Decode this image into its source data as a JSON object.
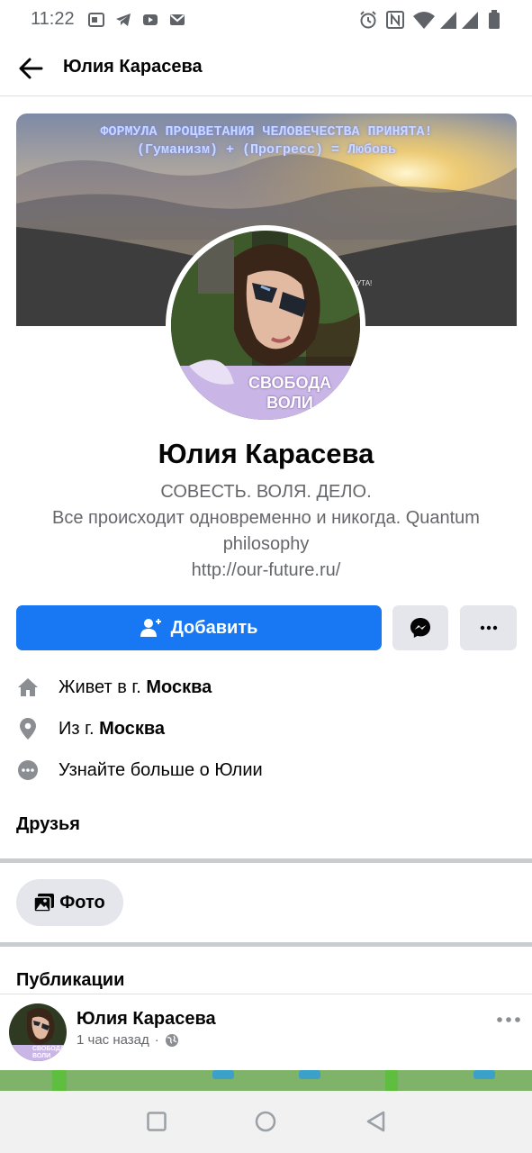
{
  "status_bar": {
    "time": "11:22"
  },
  "app_bar": {
    "title": "Юлия Карасева"
  },
  "cover": {
    "line1": "ФОРМУЛА ПРОЦВЕТАНИЯ ЧЕЛОВЕЧЕСТВА ПРИНЯТА!",
    "line2": "(Гуманизм) + (Прогресс) = Любовь",
    "small_right": "УТА!"
  },
  "avatar": {
    "caption_line1": "СВОБОДА",
    "caption_line2": "ВОЛИ"
  },
  "profile": {
    "name": "Юлия Карасева",
    "bio_line1": "СОВЕСТЬ. ВОЛЯ. ДЕЛО.",
    "bio_line2": "Все происходит одновременно и никогда. Quantum",
    "bio_line3": "philosophy",
    "bio_line4": "http://our-future.ru/"
  },
  "actions": {
    "add_label": "Добавить"
  },
  "info": {
    "lives_prefix": "Живет в г.",
    "lives_city": "Москва",
    "from_prefix": "Из г.",
    "from_city": "Москва",
    "more_about": "Узнайте больше о Юлии"
  },
  "sections": {
    "friends": "Друзья",
    "photos_chip": "Фото",
    "publications": "Публикации"
  },
  "post": {
    "author": "Юлия Карасева",
    "time": "1 час назад",
    "separator": "·",
    "avatar_caption": "СВОБОДА ВОЛИ"
  },
  "colors": {
    "primary": "#1877f2",
    "button_gray": "#e4e6eb",
    "secondary_text": "#65676b"
  }
}
